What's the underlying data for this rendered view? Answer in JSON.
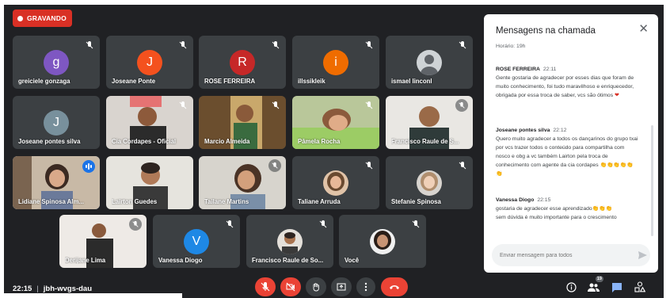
{
  "recording": {
    "label": "GRAVANDO"
  },
  "participants": [
    {
      "name": "greiciele gonzaga",
      "initial": "g",
      "color": "#7e57c2"
    },
    {
      "name": "Joseane Ponte",
      "initial": "J",
      "color": "#f4511e"
    },
    {
      "name": "ROSE FERREIRA",
      "initial": "R",
      "color": "#c62828"
    },
    {
      "name": "illssikleik",
      "initial": "i",
      "color": "#ef6c00"
    },
    {
      "name": "ismael linconl",
      "initial": ""
    },
    {
      "name": "Joseane pontes silva",
      "initial": "J",
      "color": "#78909c"
    },
    {
      "name": "Cia Cordapes - Oficial",
      "initial": ""
    },
    {
      "name": "Marcio Almeida",
      "initial": ""
    },
    {
      "name": "Pâmela Rocha",
      "initial": ""
    },
    {
      "name": "Francisco Raule de S...",
      "initial": ""
    },
    {
      "name": "Lidiane Spinosa Alm...",
      "initial": ""
    },
    {
      "name": "Lairton Guedes",
      "initial": ""
    },
    {
      "name": "Tailane Martins",
      "initial": ""
    },
    {
      "name": "Taliane Arruda",
      "initial": ""
    },
    {
      "name": "Stefanie Spinosa",
      "initial": ""
    },
    {
      "name": "Derijane Lima",
      "initial": ""
    },
    {
      "name": "Vanessa Diogo",
      "initial": "V",
      "color": "#1e88e5"
    },
    {
      "name": "Francisco Raule de So...",
      "initial": ""
    },
    {
      "name": "Você",
      "initial": ""
    }
  ],
  "meeting": {
    "time": "22:15",
    "separator": "|",
    "code": "jbh-wvgs-dau"
  },
  "controls": {
    "mic": "mic-off-icon",
    "camera": "camera-off-icon",
    "hand": "raise-hand-icon",
    "present": "present-icon",
    "more": "more-options-icon",
    "leave": "leave-call-icon"
  },
  "right_icons": {
    "info": "info-icon",
    "people": "people-icon",
    "people_count": "19",
    "chat": "chat-icon",
    "activities": "activities-icon"
  },
  "chat": {
    "title": "Mensagens na chamada",
    "note": "Horário: 19h",
    "messages": [
      {
        "sender": "ROSE FERREIRA",
        "time": "22:11",
        "text": "Gente gostaria de agradecer por esses dias que foram de muito conhecimento, foi tudo maravilhoso e enriquecedor, obrigada por essa troca de saber, vcs são ótimos",
        "emoji": "❤"
      },
      {
        "sender": "Joseane pontes silva",
        "time": "22:12",
        "text": "Quero muito agradecer a todos os dançarinos do grupo txai por vcs trazer todos o conteúdo para compartilha com nosco e obg a vc também Lairton pela troca de conhecimento com agente da cia cordapes",
        "emoji": "👏👏👏👏👏👏"
      },
      {
        "sender": "Vanessa Diogo",
        "time": "22:15",
        "text": "gostaria de agradecer esse aprendizado",
        "emoji": "👏👏👏",
        "text2": "sem dúvida é muito importante para o crescimento"
      }
    ],
    "input_placeholder": "Enviar mensagem para todos"
  },
  "colors": {
    "background": "#202124",
    "tile": "#3c4043",
    "accent": "#8ab4f8",
    "danger": "#ea4335"
  }
}
